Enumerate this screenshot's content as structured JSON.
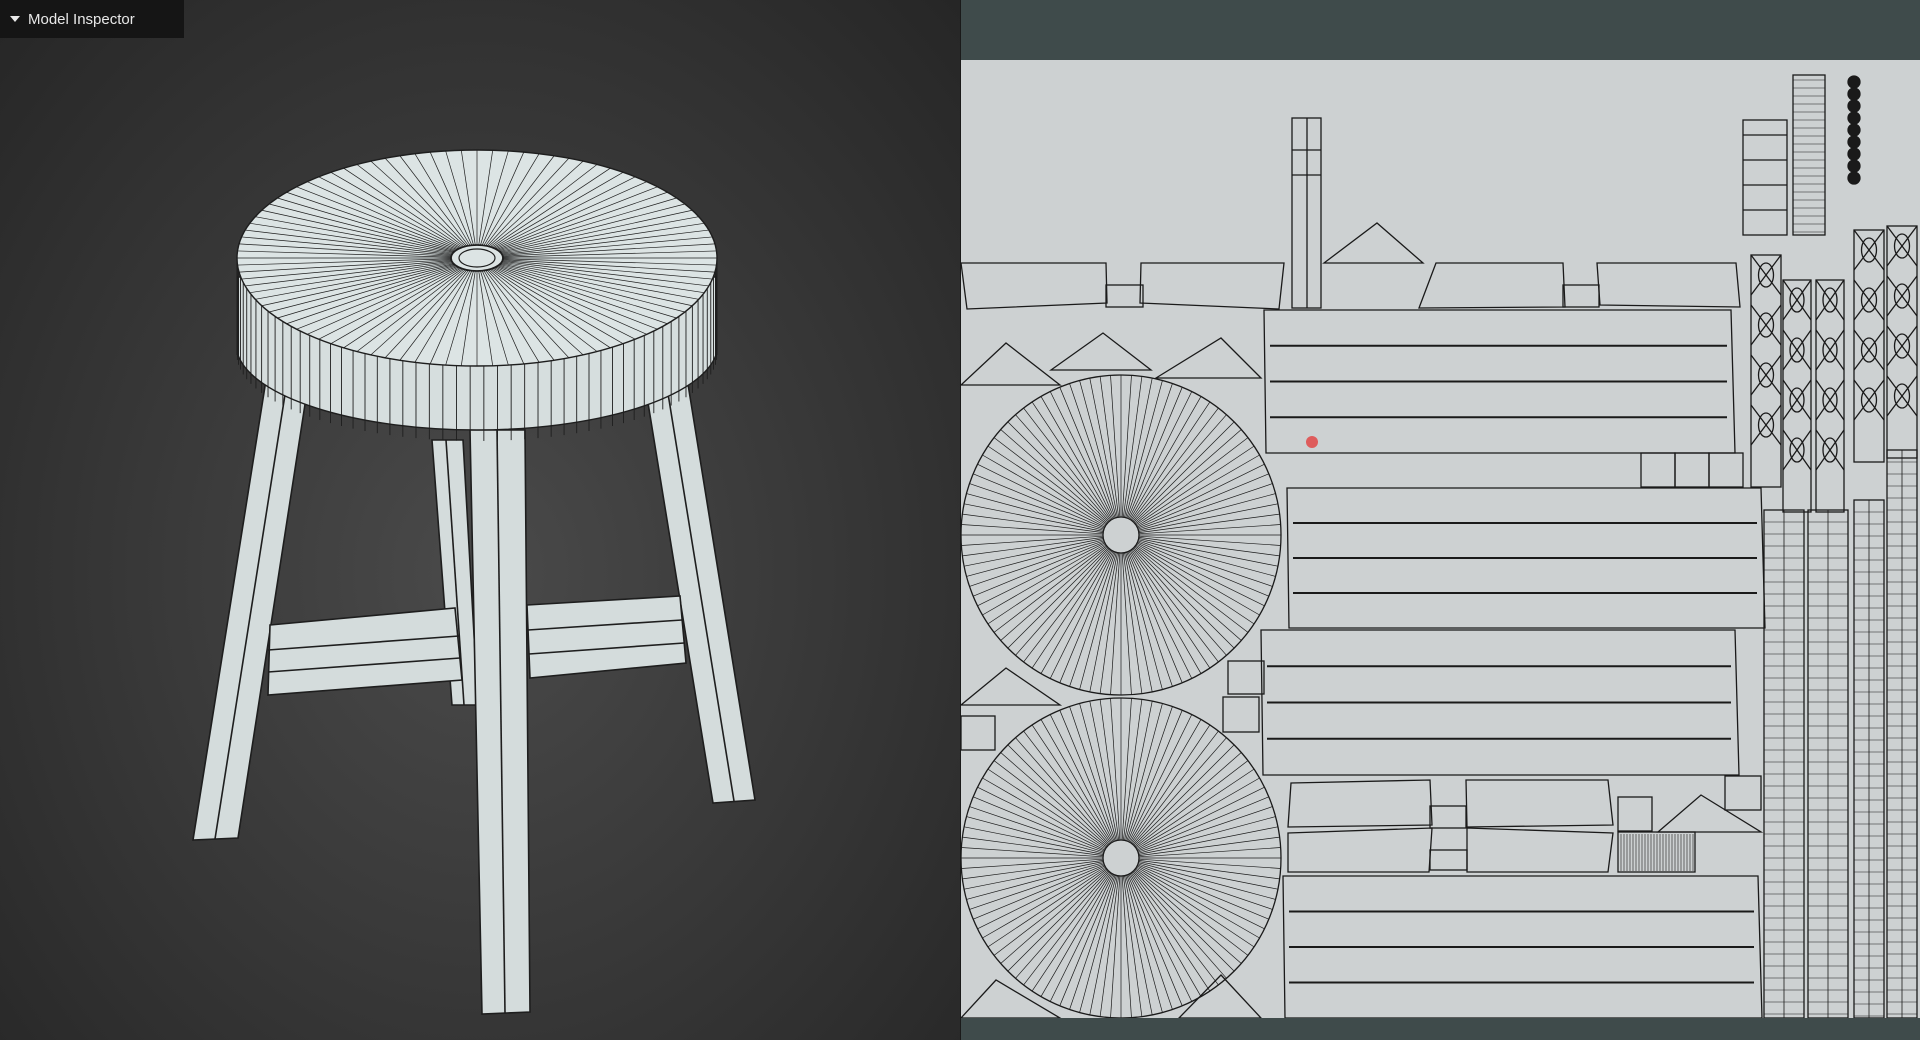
{
  "inspector": {
    "label": "Model Inspector",
    "state": "expanded",
    "caret_icon": "caret-down-icon"
  },
  "viewport": {
    "model": "stool",
    "display_mode": "wireframe",
    "colors": {
      "background": "#3a3a3a",
      "mesh_fill": "#d4dcdc",
      "wire": "#1e1e1e"
    }
  },
  "uv_editor": {
    "colors": {
      "header": "#3f4b4b",
      "canvas": "#cdd1d2",
      "wire": "#1a1a1a",
      "cursor_dot": "#e04848"
    },
    "islands": [
      "seat-top-disc",
      "seat-bottom-disc",
      "seat-side-strips",
      "leg-strips",
      "rail-strips",
      "small-patches"
    ]
  }
}
